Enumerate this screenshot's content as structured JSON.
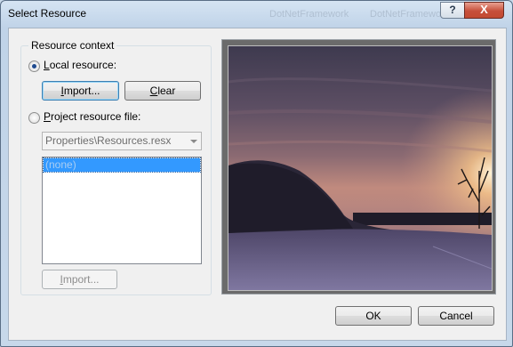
{
  "window": {
    "title": "Select Resource",
    "ghost_title_1": "DotNetFramework",
    "ghost_title_2": "DotNetFramework",
    "help_glyph": "?",
    "close_glyph": "X"
  },
  "resource_context": {
    "legend": "Resource context",
    "local_radio": {
      "prefix": "",
      "accel": "L",
      "rest": "ocal resource:",
      "checked": true
    },
    "import_button": {
      "accel": "I",
      "rest": "mport..."
    },
    "clear_button": {
      "accel": "C",
      "rest": "lear"
    },
    "project_radio": {
      "accel": "P",
      "rest": "roject resource file:",
      "checked": false
    },
    "resource_file_select": "Properties\\Resources.resx",
    "resource_list": [
      "(none)"
    ],
    "project_import_button": {
      "accel": "I",
      "rest": "mport..."
    }
  },
  "preview": {
    "description_icon": "winter-sunset-landscape-image"
  },
  "footer": {
    "ok_label": "OK",
    "cancel_label": "Cancel"
  },
  "colors": {
    "selection": "#3399ff",
    "close_button": "#c7503b",
    "title_bar": "#c0d3e8"
  }
}
